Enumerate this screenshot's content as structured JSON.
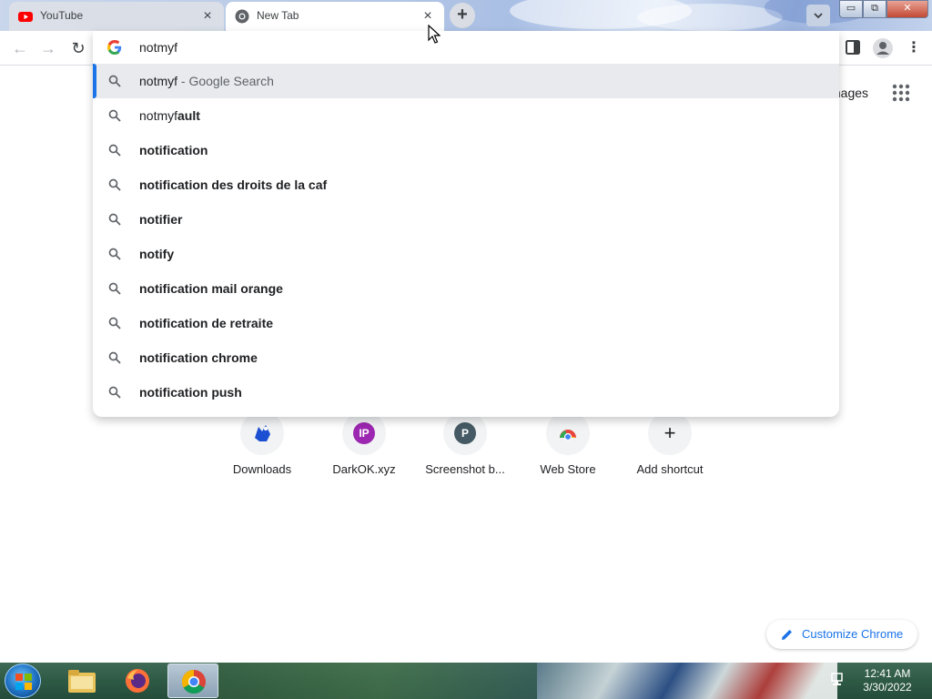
{
  "tabs": [
    {
      "title": "YouTube",
      "favicon": "youtube-icon",
      "close": "×"
    },
    {
      "title": "New Tab",
      "favicon": "chrome-icon",
      "close": "×"
    }
  ],
  "new_tab_symbol": "+",
  "window_controls": {
    "minimize": "▭",
    "maximize": "⧉",
    "close": "✕"
  },
  "toolbar": {
    "back": "←",
    "forward": "→",
    "reload": "↻",
    "menu": "⋮"
  },
  "omnibox": {
    "input_value": "notmyf",
    "suggestions": [
      {
        "typed": "notmyf",
        "rest": "",
        "suffix": " - Google Search",
        "selected": true
      },
      {
        "typed": "notmyf",
        "rest": "ault",
        "suffix": ""
      },
      {
        "typed": "",
        "rest": "notification",
        "suffix": ""
      },
      {
        "typed": "",
        "rest": "notification des droits de la caf",
        "suffix": ""
      },
      {
        "typed": "",
        "rest": "notifier",
        "suffix": ""
      },
      {
        "typed": "",
        "rest": "notify",
        "suffix": ""
      },
      {
        "typed": "",
        "rest": "notification mail orange",
        "suffix": ""
      },
      {
        "typed": "",
        "rest": "notification de retraite",
        "suffix": ""
      },
      {
        "typed": "",
        "rest": "notification chrome",
        "suffix": ""
      },
      {
        "typed": "",
        "rest": "notification push",
        "suffix": ""
      }
    ]
  },
  "ntp": {
    "images_link": "mages",
    "shortcuts": [
      {
        "label": "Downloads",
        "icon": "downloads-site-icon"
      },
      {
        "label": "DarkOK.xyz",
        "icon": "letter-badge",
        "letter": "IP",
        "color": "#9c27b0"
      },
      {
        "label": "Screenshot b...",
        "icon": "letter-badge",
        "letter": "P",
        "color": "#455a64"
      },
      {
        "label": "Web Store",
        "icon": "web-store-icon"
      },
      {
        "label": "Add shortcut",
        "icon": "plus-icon",
        "symbol": "+"
      }
    ],
    "customize_label": "Customize Chrome"
  },
  "taskbar": {
    "time": "12:41 AM",
    "date": "3/30/2022",
    "apps": [
      "file-explorer-icon",
      "firefox-icon",
      "chrome-icon"
    ]
  },
  "colors": {
    "accent": "#1a73e8",
    "selected_row": "#e8eaed"
  }
}
